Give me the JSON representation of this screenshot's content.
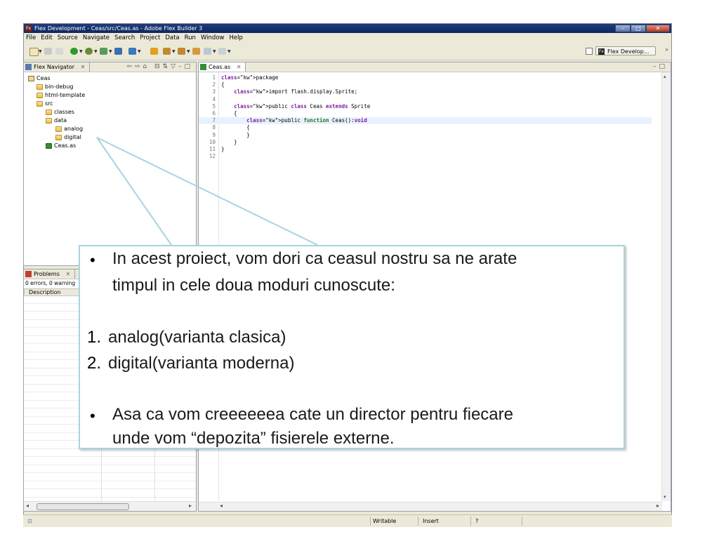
{
  "window": {
    "title": "Flex Development - Ceas/src/Ceas.as - Adobe Flex Builder 3",
    "app_icon": "Fx"
  },
  "menu": [
    "File",
    "Edit",
    "Source",
    "Navigate",
    "Search",
    "Project",
    "Data",
    "Run",
    "Window",
    "Help"
  ],
  "perspective": {
    "label": "Flex Develop...",
    "icon": "Fx"
  },
  "navigator": {
    "tab_label": "Flex Navigator",
    "tree": [
      {
        "label": "Ceas",
        "type": "project"
      },
      {
        "label": "bin-debug",
        "type": "folder"
      },
      {
        "label": "html-template",
        "type": "folder"
      },
      {
        "label": "src",
        "type": "folder"
      },
      {
        "label": "classes",
        "type": "folder"
      },
      {
        "label": "data",
        "type": "folder"
      },
      {
        "label": "analog",
        "type": "folder"
      },
      {
        "label": "digital",
        "type": "folder"
      },
      {
        "label": "Ceas.as",
        "type": "file"
      }
    ]
  },
  "problems": {
    "tab_label": "Problems",
    "summary": "0 errors, 0 warning",
    "column": "Description"
  },
  "editor": {
    "tab_label": "Ceas.as",
    "lines": [
      {
        "n": "1",
        "text": "package"
      },
      {
        "n": "2",
        "text": "{"
      },
      {
        "n": "3",
        "text": "    import flash.display.Sprite;"
      },
      {
        "n": "4",
        "text": ""
      },
      {
        "n": "5",
        "text": "    public class Ceas extends Sprite"
      },
      {
        "n": "6",
        "text": "    {"
      },
      {
        "n": "7",
        "text": "        public function Ceas():void"
      },
      {
        "n": "8",
        "text": "        {"
      },
      {
        "n": "9",
        "text": "        }"
      },
      {
        "n": "10",
        "text": "    }"
      },
      {
        "n": "11",
        "text": "}"
      },
      {
        "n": "12",
        "text": ""
      }
    ]
  },
  "status": {
    "writable": "Writable",
    "insert": "Insert",
    "position": "?"
  },
  "overlay": {
    "bullet1_line1": "In acest proiect, vom dori ca ceasul nostru sa ne arate",
    "bullet1_line2": "timpul in cele doua moduri cunoscute:",
    "item1_num": "1.",
    "item1": "analog(varianta clasica)",
    "item2_num": "2.",
    "item2": "digital(varianta moderna)",
    "bullet2_line1": "Asa ca vom creeeeeea cate un director pentru fiecare",
    "bullet2_line2": "unde vom “depozita” fisierele externe.",
    "bullet_char": "•"
  },
  "colors": {
    "titlebar": "#0e2760",
    "callout_border": "#a8d4e1",
    "current_line": "#e8f2fe",
    "keyword": "#7a1aa0"
  }
}
